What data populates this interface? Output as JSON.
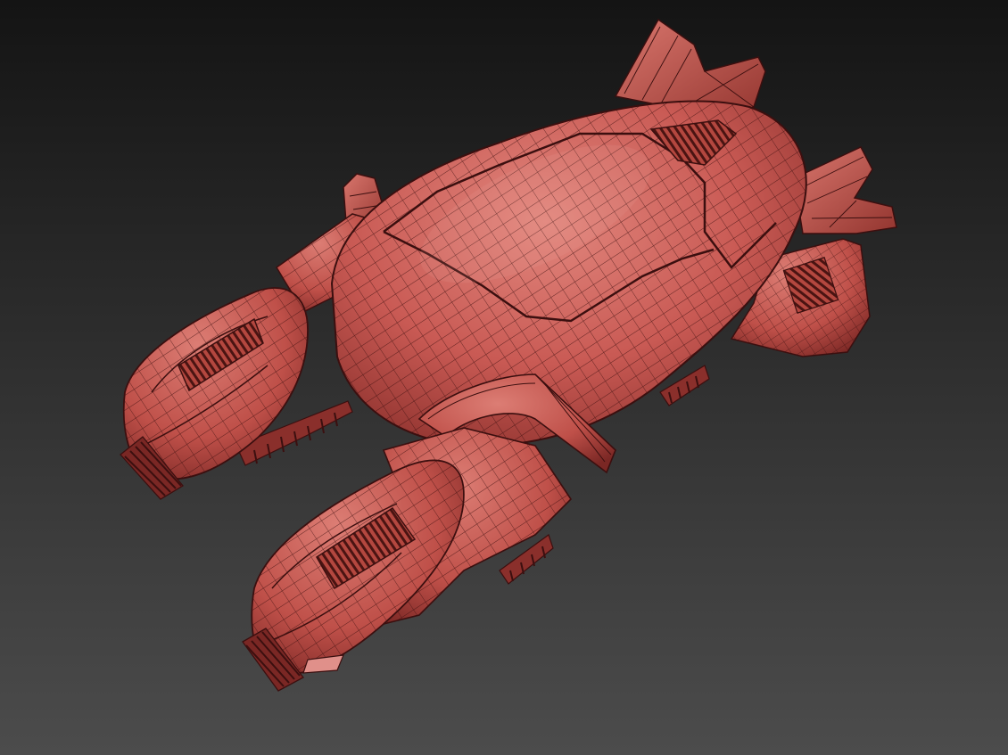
{
  "viewport": {
    "background_top": "#141414",
    "background_bottom": "#4c4c4c",
    "model_color": "#c95a54",
    "model_shadow": "#7a2724",
    "model_highlight": "#e89a90",
    "wire_color": "#3b0f0f"
  }
}
